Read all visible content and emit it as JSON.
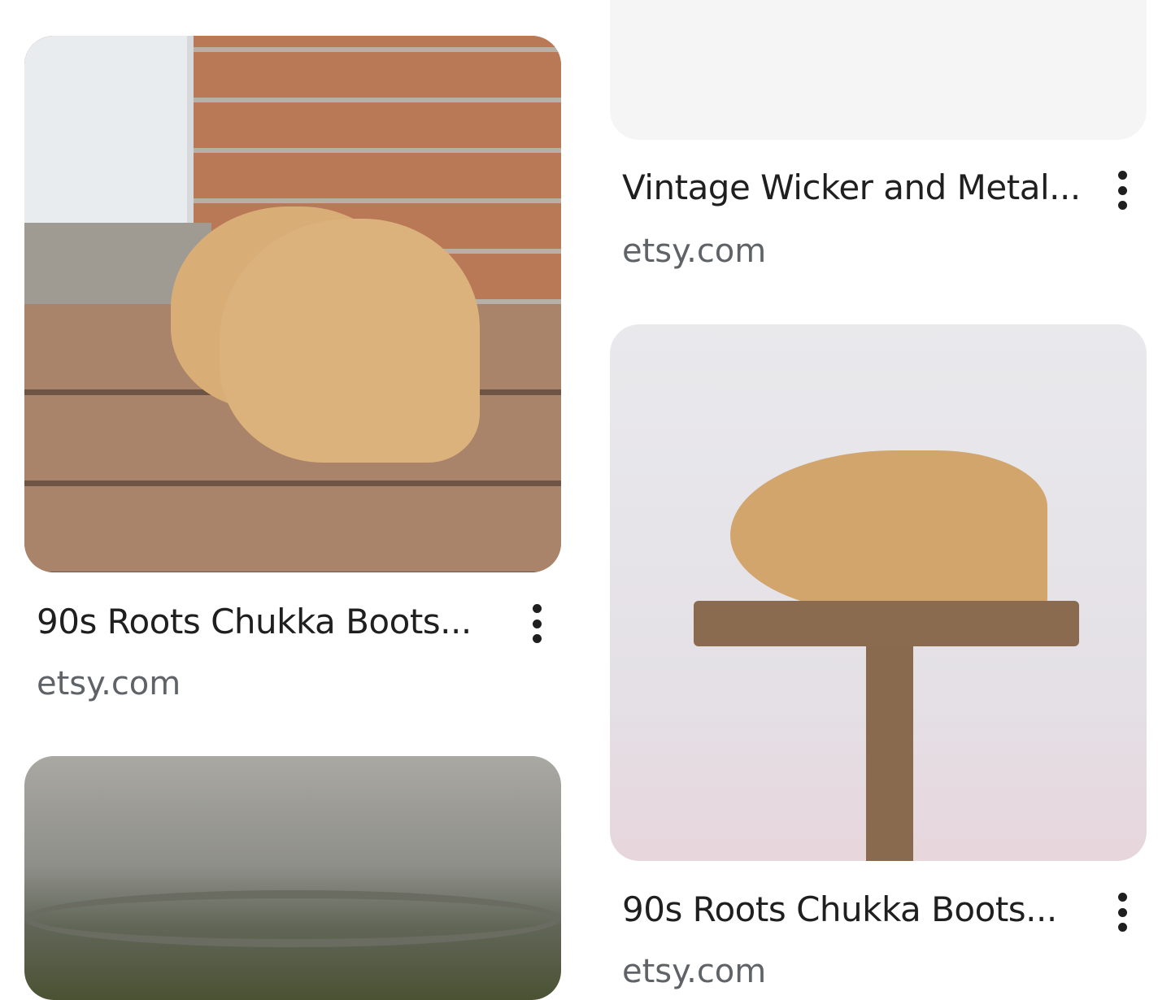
{
  "cards": [
    {
      "title": "90s Roots Chukka Boots...",
      "source": "etsy.com",
      "image_alt": "Tan chukka boots on wooden porch"
    },
    {
      "title": "Vintage Wicker and Metal...",
      "source": "etsy.com",
      "image_alt": ""
    },
    {
      "title": "90s Roots Chukka Boots...",
      "source": "etsy.com",
      "image_alt": "Single tan chukka boot on wooden stand"
    },
    {
      "title": "",
      "source": "",
      "image_alt": "Metal tin"
    }
  ],
  "colors": {
    "title_text": "#1f1f1f",
    "source_text": "#5f6368",
    "placeholder": "#f5f5f5"
  },
  "icons": {
    "more": "more-vert-icon"
  }
}
